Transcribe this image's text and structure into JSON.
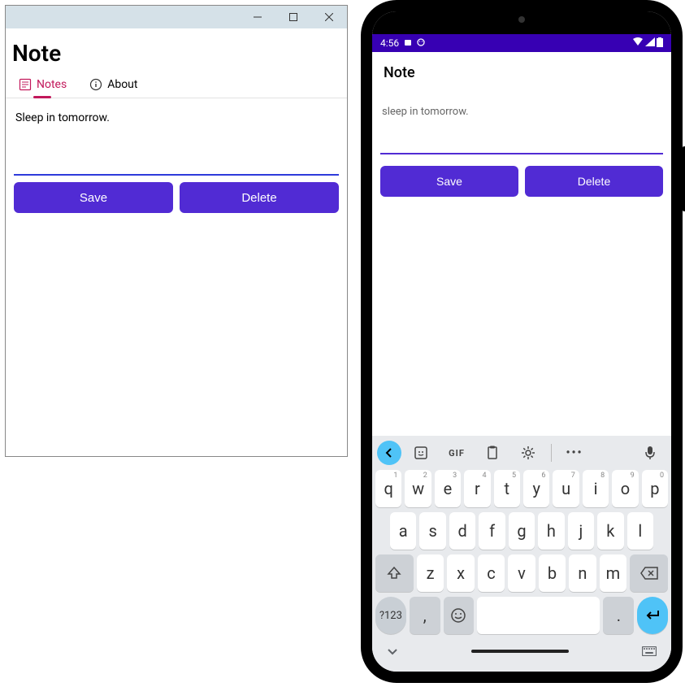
{
  "desktop": {
    "title": "Note",
    "tabs": {
      "notes": "Notes",
      "about": "About"
    },
    "note_text": "Sleep in tomorrow.",
    "buttons": {
      "save": "Save",
      "delete": "Delete"
    }
  },
  "android": {
    "status_time": "4:56",
    "title": "Note",
    "note_text": "sleep in tomorrow.",
    "buttons": {
      "save": "Save",
      "delete": "Delete"
    }
  },
  "keyboard": {
    "toolbar_gif": "GIF",
    "sym_key": "?123",
    "row1": [
      "q",
      "w",
      "e",
      "r",
      "t",
      "y",
      "u",
      "i",
      "o",
      "p"
    ],
    "row1_sup": [
      "1",
      "2",
      "3",
      "4",
      "5",
      "6",
      "7",
      "8",
      "9",
      "0"
    ],
    "row2": [
      "a",
      "s",
      "d",
      "f",
      "g",
      "h",
      "j",
      "k",
      "l"
    ],
    "row3": [
      "z",
      "x",
      "c",
      "v",
      "b",
      "n",
      "m"
    ],
    "comma": ",",
    "period": "."
  }
}
